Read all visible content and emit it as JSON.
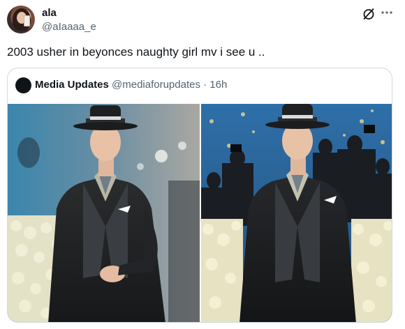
{
  "tweet": {
    "author": {
      "display_name": "ala",
      "handle": "@aIaaaa_e"
    },
    "text": "2003 usher in beyonces naughty girl mv i see u ..",
    "icons": [
      "grok-icon",
      "more-icon"
    ]
  },
  "quoted_tweet": {
    "display_name": "Media Updates",
    "handle_time": "@mediaforupdates · 16h",
    "images": [
      {
        "name": "photo-left",
        "description": "man in black fedora and pinstripe suit"
      },
      {
        "name": "photo-right",
        "description": "man in black fedora and pinstripe suit in front of photographers"
      }
    ]
  },
  "colors": {
    "text_primary": "#0f1419",
    "text_secondary": "#536471",
    "border": "#cfd9de",
    "backdrop_blue": "#2f6fa6"
  }
}
